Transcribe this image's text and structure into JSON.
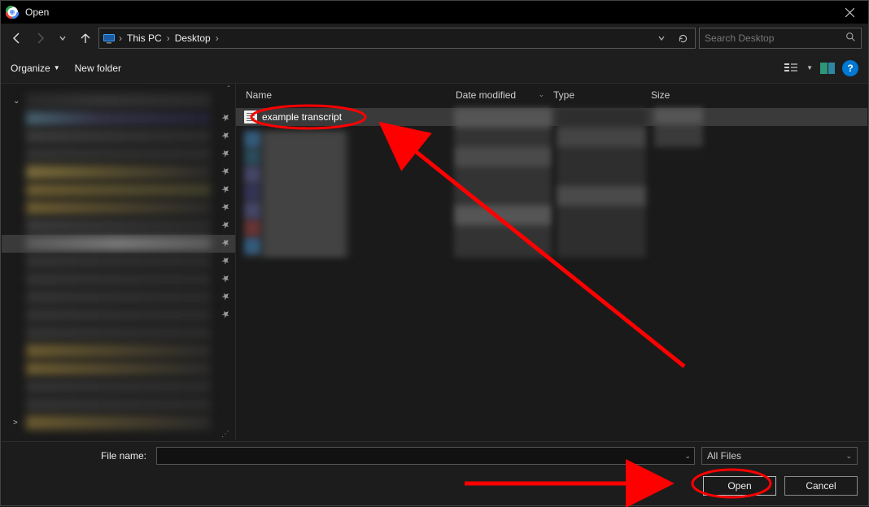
{
  "titlebar": {
    "title": "Open"
  },
  "nav": {
    "back_tip": "Back",
    "fwd_tip": "Forward",
    "recent_tip": "Recent",
    "up_tip": "Up"
  },
  "breadcrumbs": {
    "root": "This PC",
    "leaf": "Desktop"
  },
  "search": {
    "placeholder": "Search Desktop"
  },
  "toolbar": {
    "organize": "Organize",
    "newfolder": "New folder"
  },
  "columns": {
    "name": "Name",
    "date": "Date modified",
    "type": "Type",
    "size": "Size"
  },
  "sidebar": {
    "items": [
      {
        "pinned": false,
        "selected": false,
        "bg": "linear-gradient(90deg,#2a2a2a,#333 40%,#2a2a2a)"
      },
      {
        "pinned": true,
        "selected": false,
        "bg": "linear-gradient(90deg,#47616f,#334 40%,#223)"
      },
      {
        "pinned": true,
        "selected": false,
        "bg": "linear-gradient(90deg,#3a3a3a,#2a2a2a)"
      },
      {
        "pinned": true,
        "selected": false,
        "bg": "linear-gradient(90deg,#333,#2a2a2a)"
      },
      {
        "pinned": true,
        "selected": false,
        "bg": "linear-gradient(90deg,#7a6a3a,#5a5030 40%,#2a2a2a)"
      },
      {
        "pinned": true,
        "selected": false,
        "bg": "linear-gradient(90deg,#6a5a30,#3a3a2a)"
      },
      {
        "pinned": true,
        "selected": false,
        "bg": "linear-gradient(90deg,#6a5a30,#2a2a2a)"
      },
      {
        "pinned": true,
        "selected": false,
        "bg": "linear-gradient(90deg,#3a3a3a,#2a2a2a)"
      },
      {
        "pinned": true,
        "selected": true,
        "bg": "linear-gradient(90deg,#5a5a5a,#777 50%,#5a5a5a)"
      },
      {
        "pinned": true,
        "selected": false,
        "bg": "linear-gradient(90deg,#333,#2a2a2a)"
      },
      {
        "pinned": true,
        "selected": false,
        "bg": "linear-gradient(90deg,#333,#2a2a2a)"
      },
      {
        "pinned": true,
        "selected": false,
        "bg": "linear-gradient(90deg,#333,#2a2a2a)"
      },
      {
        "pinned": true,
        "selected": false,
        "bg": "linear-gradient(90deg,#333,#2a2a2a)"
      },
      {
        "pinned": false,
        "selected": false,
        "bg": "linear-gradient(90deg,#333,#2a2a2a)"
      },
      {
        "pinned": false,
        "selected": false,
        "bg": "linear-gradient(90deg,#6a5a30,#2a2a2a)"
      },
      {
        "pinned": false,
        "selected": false,
        "bg": "linear-gradient(90deg,#6a5a30,#2a2a2a)"
      },
      {
        "pinned": false,
        "selected": false,
        "bg": "linear-gradient(90deg,#333,#2a2a2a)"
      },
      {
        "pinned": false,
        "selected": false,
        "bg": "linear-gradient(90deg,#333,#2a2a2a)"
      },
      {
        "pinned": false,
        "selected": false,
        "bg": "linear-gradient(90deg,#6a5a30,#2a2a2a)"
      }
    ]
  },
  "files": {
    "selected_file": "example transcript"
  },
  "footer": {
    "filename_label": "File name:",
    "filename_value": "",
    "filter_label": "All Files",
    "open": "Open",
    "cancel": "Cancel"
  },
  "annotations": {
    "highlight_file": "example transcript",
    "highlight_button": "Open"
  }
}
